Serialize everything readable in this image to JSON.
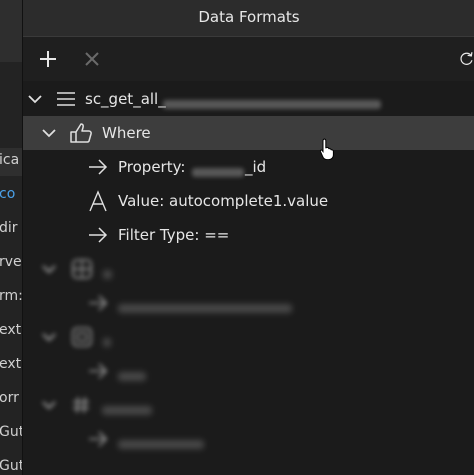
{
  "panel": {
    "title": "Data Formats"
  },
  "toolbar": {
    "add_icon": "plus-icon",
    "remove_icon": "close-icon",
    "refresh_icon": "refresh-icon"
  },
  "background_fragments": [
    "ica",
    "co",
    "dir",
    "rve",
    "rm:",
    "ext",
    "ext",
    "orr",
    "Gut",
    "Gut"
  ],
  "tree": {
    "root": {
      "label": "sc_get_all_",
      "icon": "list-icon"
    },
    "where": {
      "label": "Where",
      "icon": "thumbs-up-icon"
    },
    "property": {
      "label": "Property: ",
      "value": "_id",
      "icon": "arrow-right-icon"
    },
    "value": {
      "label": "Value: autocomplete1.value",
      "icon": "letter-a-icon"
    },
    "filter_type": {
      "label": "Filter Type: ==",
      "icon": "arrow-right-icon"
    }
  },
  "colors": {
    "accent_blue": "#4aa0e8",
    "selected_row": "#3d3d3d"
  }
}
